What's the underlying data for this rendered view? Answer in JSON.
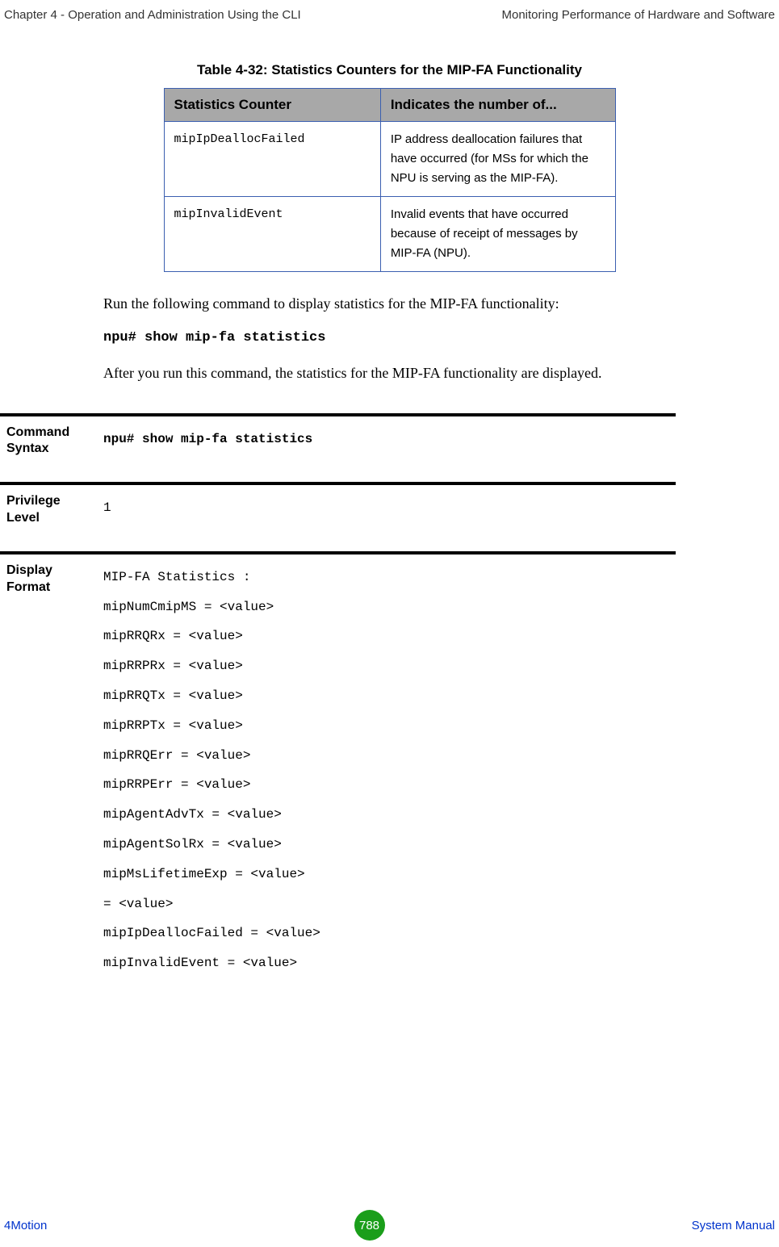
{
  "header": {
    "left": "Chapter 4 - Operation and Administration Using the CLI",
    "right": "Monitoring Performance of Hardware and Software"
  },
  "table": {
    "caption": "Table 4-32: Statistics Counters for the MIP-FA Functionality",
    "headers": {
      "col1": "Statistics Counter",
      "col2": "Indicates the number of..."
    },
    "rows": [
      {
        "counter": "mipIpDeallocFailed",
        "description": "IP address deallocation failures that have occurred (for MSs for which the NPU is serving as the MIP-FA)."
      },
      {
        "counter": "mipInvalidEvent",
        "description": "Invalid events that have occurred because of receipt of messages by MIP-FA (NPU)."
      }
    ]
  },
  "body": {
    "para1": "Run the following command to display statistics for the MIP-FA functionality:",
    "command1": "npu# show mip-fa statistics",
    "para2": "After you run this command, the statistics for the MIP-FA functionality are displayed."
  },
  "sections": {
    "syntax": {
      "label": "Command Syntax",
      "value": "npu# show mip-fa statistics"
    },
    "privilege": {
      "label": "Privilege Level",
      "value": "1"
    },
    "display": {
      "label": "Display Format",
      "lines": [
        "MIP-FA Statistics :",
        "mipNumCmipMS = <value>",
        "mipRRQRx = <value>",
        "mipRRPRx = <value>",
        "mipRRQTx = <value>",
        "mipRRPTx = <value>",
        "mipRRQErr = <value>",
        "mipRRPErr = <value>",
        "mipAgentAdvTx = <value>",
        "mipAgentSolRx = <value>",
        "mipMsLifetimeExp = <value>",
        " = <value>",
        "mipIpDeallocFailed = <value>",
        "mipInvalidEvent = <value>"
      ]
    }
  },
  "footer": {
    "left": "4Motion",
    "page": "788",
    "right": "System Manual"
  }
}
